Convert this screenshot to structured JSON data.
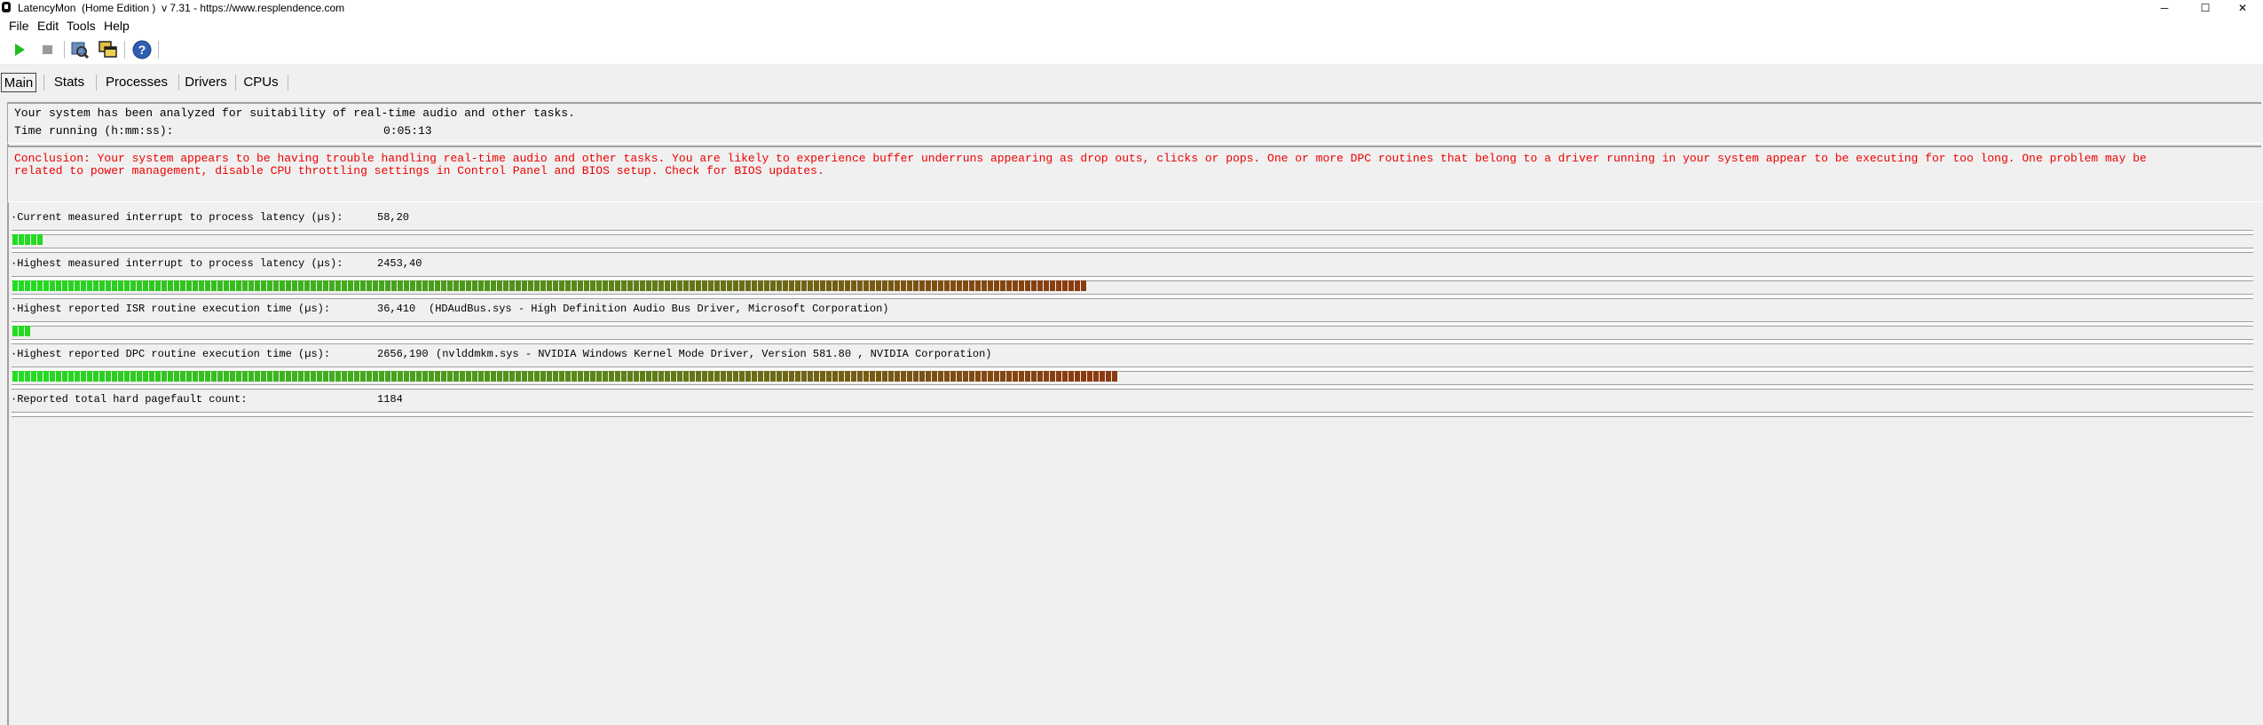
{
  "window": {
    "title": "LatencyMon  (Home Edition )  v 7.31 - https://www.resplendence.com",
    "controls": [
      "─",
      "☐",
      "✕"
    ]
  },
  "menu": {
    "items": [
      "File",
      "Edit",
      "Tools",
      "Help"
    ]
  },
  "toolbar": {
    "buttons": [
      "play-icon",
      "stop-icon",
      "search-icon",
      "windows-icon",
      "help-icon"
    ]
  },
  "tabs": {
    "items": [
      "Main",
      "Stats",
      "Processes",
      "Drivers",
      "CPUs"
    ],
    "active": "Main"
  },
  "summary": {
    "line1": "Your system has been analyzed for suitability of real-time audio and other tasks.",
    "time_label": "Time running (h:mm:ss):",
    "time_value": "0:05:13"
  },
  "conclusion": {
    "line1": "Conclusion: Your system appears to be having trouble handling real-time audio and other tasks. You are likely to experience buffer underruns appearing as drop outs, clicks or pops. One or more DPC routines that belong to a driver running in your system appear to be executing for too long. One problem may be",
    "line2": "related to power management, disable CPU throttling settings in Control Panel and BIOS setup. Check for BIOS updates.",
    "color": "#ee0000"
  },
  "metrics": {
    "current_latency": {
      "label": "Current measured interrupt to process latency (µs):",
      "value": "58,20",
      "level": 0.015
    },
    "highest_latency": {
      "label": "Highest measured interrupt to process latency (µs):",
      "value": "2453,40",
      "level": 0.48
    },
    "highest_isr": {
      "label": "Highest reported ISR routine execution time (µs):",
      "value": "36,410",
      "detail": "(HDAudBus.sys - High Definition Audio Bus Driver, Microsoft Corporation)",
      "level": 0.009
    },
    "highest_dpc": {
      "label": "Highest reported DPC routine execution time (µs):",
      "value": "2656,190",
      "detail": "(nvlddmkm.sys - NVIDIA Windows Kernel Mode Driver, Version 581.80 , NVIDIA Corporation)",
      "level": 0.494
    },
    "pagefault": {
      "label": "Reported total hard pagefault count:",
      "value": "1184"
    }
  },
  "colors": {
    "bar_green": "#22dd22",
    "bar_brown": "#8b3a10",
    "conclusion_red": "#ee0000"
  }
}
